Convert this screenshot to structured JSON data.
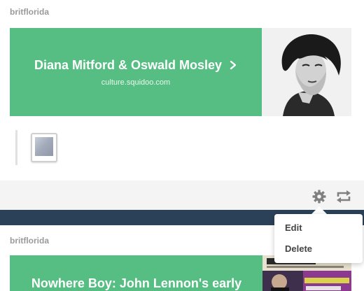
{
  "posts": [
    {
      "username": "britflorida",
      "link": {
        "title": "Diana Mitford & Oswald Mosley",
        "domain": "culture.squidoo.com"
      }
    },
    {
      "username": "britflorida",
      "link": {
        "title": "Nowhere Boy: John Lennon's early"
      }
    }
  ],
  "footer": {
    "icons": [
      "gear-icon",
      "reblog-icon"
    ]
  },
  "menu": {
    "items": [
      "Edit",
      "Delete"
    ]
  },
  "colors": {
    "card": "#56bd83",
    "separator": "#2b4158",
    "footer_bg": "#f4f4f4",
    "username": "#9a9a9a"
  }
}
